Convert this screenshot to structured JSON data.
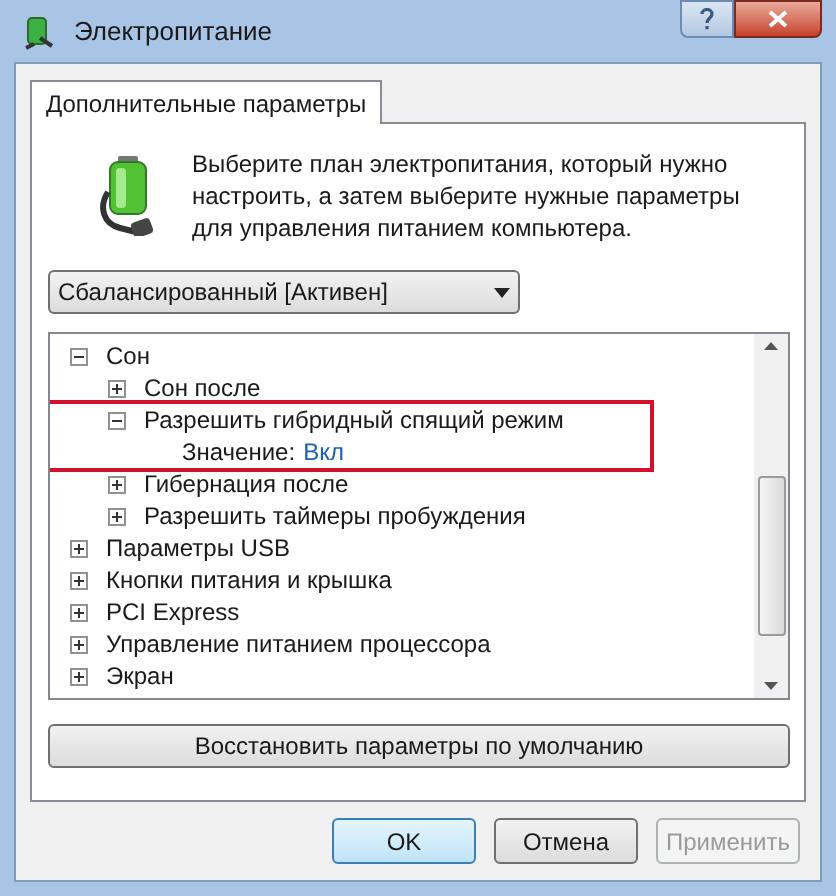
{
  "window": {
    "title": "Электропитание"
  },
  "tabs": [
    {
      "label": "Дополнительные параметры",
      "selected": true
    }
  ],
  "intro": "Выберите план электропитания, который нужно настроить, а затем выберите нужные параметры для управления питанием компьютера.",
  "plan_select": {
    "value": "Сбалансированный [Активен]"
  },
  "tree": [
    {
      "label": "Сон",
      "expanded": true,
      "children": [
        {
          "label": "Сон после",
          "expanded": false
        },
        {
          "label": "Разрешить гибридный спящий режим",
          "expanded": true,
          "highlighted": true,
          "setting": {
            "label": "Значение:",
            "value": "Вкл"
          }
        },
        {
          "label": "Гибернация после",
          "expanded": false
        },
        {
          "label": "Разрешить таймеры пробуждения",
          "expanded": false
        }
      ]
    },
    {
      "label": "Параметры USB",
      "expanded": false
    },
    {
      "label": "Кнопки питания и крышка",
      "expanded": false
    },
    {
      "label": "PCI Express",
      "expanded": false
    },
    {
      "label": "Управление питанием процессора",
      "expanded": false
    },
    {
      "label": "Экран",
      "expanded": false
    }
  ],
  "restore_button": "Восстановить параметры по умолчанию",
  "buttons": [
    {
      "label": "OK",
      "default": true,
      "disabled": false
    },
    {
      "label": "Отмена",
      "default": false,
      "disabled": false
    },
    {
      "label": "Применить",
      "default": false,
      "disabled": true
    }
  ]
}
